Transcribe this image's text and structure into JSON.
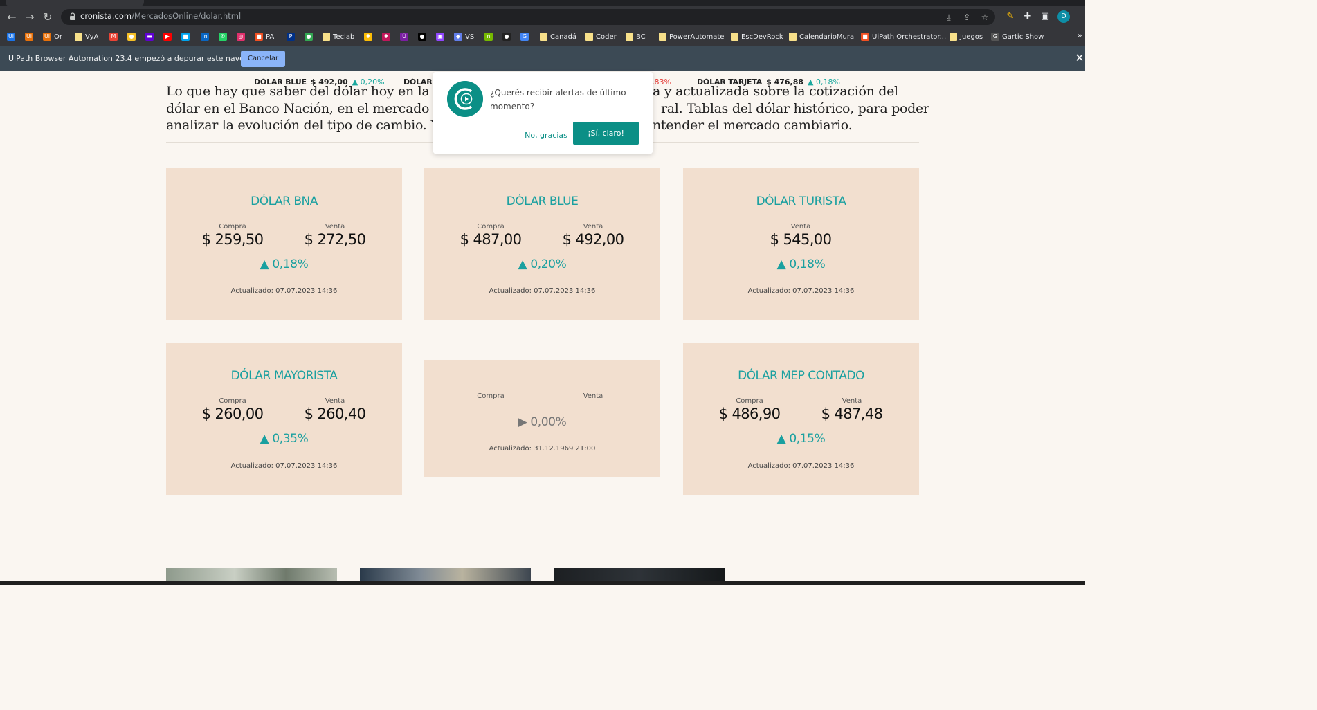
{
  "browser": {
    "url_host": "cronista.com",
    "url_path": "/MercadosOnline/dolar.html",
    "profile_initial": "D",
    "bookmarks": [
      {
        "label": "",
        "color": "#1a73e8",
        "glyph": "Ui"
      },
      {
        "label": "",
        "color": "#e8710a",
        "glyph": "Ui"
      },
      {
        "label": "Or",
        "color": "#e8710a",
        "glyph": "Ui"
      },
      {
        "label": "VyA",
        "folder": true
      },
      {
        "label": "",
        "color": "#ea4335",
        "glyph": "M"
      },
      {
        "label": "",
        "color": "#f6c026",
        "glyph": "●"
      },
      {
        "label": "",
        "color": "#6001d2",
        "glyph": "▬"
      },
      {
        "label": "",
        "color": "#ff0000",
        "glyph": "▶"
      },
      {
        "label": "",
        "color": "#00a4ef",
        "glyph": "■"
      },
      {
        "label": "",
        "color": "#0a66c2",
        "glyph": "in"
      },
      {
        "label": "",
        "color": "#25d366",
        "glyph": "✆"
      },
      {
        "label": "",
        "color": "#e1306c",
        "glyph": "◎"
      },
      {
        "label": "PA",
        "color": "#f25022",
        "glyph": "■"
      },
      {
        "label": "",
        "color": "#003087",
        "glyph": "P"
      },
      {
        "label": "",
        "color": "#34a853",
        "glyph": "●"
      },
      {
        "label": "Teclab",
        "folder": true
      },
      {
        "label": "",
        "color": "#fbbc05",
        "glyph": "✱"
      },
      {
        "label": "",
        "color": "#c2185b",
        "glyph": "✱"
      },
      {
        "label": "",
        "color": "#7b1fa2",
        "glyph": "Ü"
      },
      {
        "label": "",
        "color": "#000000",
        "glyph": "●"
      },
      {
        "label": "",
        "color": "#9146ff",
        "glyph": "▣"
      },
      {
        "label": "VS",
        "color": "#627eea",
        "glyph": "◆"
      },
      {
        "label": "",
        "color": "#76b900",
        "glyph": "n"
      },
      {
        "label": "",
        "color": "#222222",
        "glyph": "●"
      },
      {
        "label": "",
        "color": "#4285f4",
        "glyph": "G"
      },
      {
        "label": "Canadá",
        "folder": true
      },
      {
        "label": "Coder",
        "folder": true
      },
      {
        "label": "BC",
        "folder": true
      },
      {
        "label": "PowerAutomate",
        "folder": true
      },
      {
        "label": "EscDevRock",
        "folder": true
      },
      {
        "label": "CalendarioMural",
        "folder": true
      },
      {
        "label": "UiPath Orchestrator...",
        "color": "#f25022",
        "glyph": "■"
      },
      {
        "label": "Juegos",
        "folder": true
      },
      {
        "label": "Gartic Show",
        "color": "#555555",
        "glyph": "G"
      }
    ],
    "debug_banner": {
      "message": "UiPath Browser Automation 23.4 empezó a depurar este navegador",
      "cancel_label": "Cancelar",
      "close_glyph": "✕"
    }
  },
  "ticker": [
    {
      "name": "DÓLAR BLUE",
      "value": "$ 492,00",
      "change": "▲ 0,20%",
      "negative": false
    },
    {
      "name": "DÓLAR I",
      "value": "",
      "change": "",
      "negative": false
    },
    {
      "name": "",
      "value": "",
      "change": ",83%",
      "negative": true
    },
    {
      "name": "DÓLAR TARJETA",
      "value": "$ 476,88",
      "change": "▲ 0,18%",
      "negative": false
    }
  ],
  "intro": {
    "text": "Lo que hay que saber del dólar hoy en la Argentina. Información completa y actualizada sobre la cotización del dólar en el Banco Nación, en el mercado mayorista, el MEP y el dólar blue o informal. Tablas del dólar histórico, para poder analizar la evolución del tipo de cambio. Y todas las noticias para entender el mercado cambiario.",
    "line1": "Lo que hay que saber del dólar hoy en la A",
    "line1b": "a y actualizada sobre la cotización del",
    "line2": "dólar en el Banco Nación, en el mercado m",
    "line2b": "ral. Tablas del dólar histórico, para poder",
    "line3": "analizar la evolución del tipo de cambio. Y",
    "line3b": "ntender el mercado cambiario."
  },
  "cards": [
    {
      "title": "DÓLAR BNA",
      "compra_label": "Compra",
      "compra": "$ 259,50",
      "venta_label": "Venta",
      "venta": "$ 272,50",
      "change": "▲ 0,18%",
      "updated": "Actualizado: 07.07.2023 14:36"
    },
    {
      "title": "DÓLAR BLUE",
      "compra_label": "Compra",
      "compra": "$ 487,00",
      "venta_label": "Venta",
      "venta": "$ 492,00",
      "change": "▲ 0,20%",
      "updated": "Actualizado: 07.07.2023 14:36"
    },
    {
      "title": "DÓLAR TURISTA",
      "venta_label": "Venta",
      "venta": "$ 545,00",
      "change": "▲ 0,18%",
      "updated": "Actualizado: 07.07.2023 14:36"
    },
    {
      "title": "DÓLAR MAYORISTA",
      "compra_label": "Compra",
      "compra": "$ 260,00",
      "venta_label": "Venta",
      "venta": "$ 260,40",
      "change": "▲ 0,35%",
      "updated": "Actualizado: 07.07.2023 14:36"
    },
    {
      "title": "",
      "compra_label": "Compra",
      "venta_label": "Venta",
      "change": "▶ 0,00%",
      "updated": "Actualizado: 31.12.1969 21:00"
    },
    {
      "title": "DÓLAR MEP CONTADO",
      "compra_label": "Compra",
      "compra": "$ 486,90",
      "venta_label": "Venta",
      "venta": "$ 487,48",
      "change": "▲ 0,15%",
      "updated": "Actualizado: 07.07.2023 14:36"
    }
  ],
  "popup": {
    "message": "¿Querés recibir alertas de último momento?",
    "no_label": "No, gracias",
    "yes_label": "¡Sí, claro!"
  },
  "colors": {
    "accent": "#1aa0a0",
    "card_bg": "#f2dfcf",
    "page_bg": "#faf6f1",
    "brand": "#0b8f86"
  }
}
